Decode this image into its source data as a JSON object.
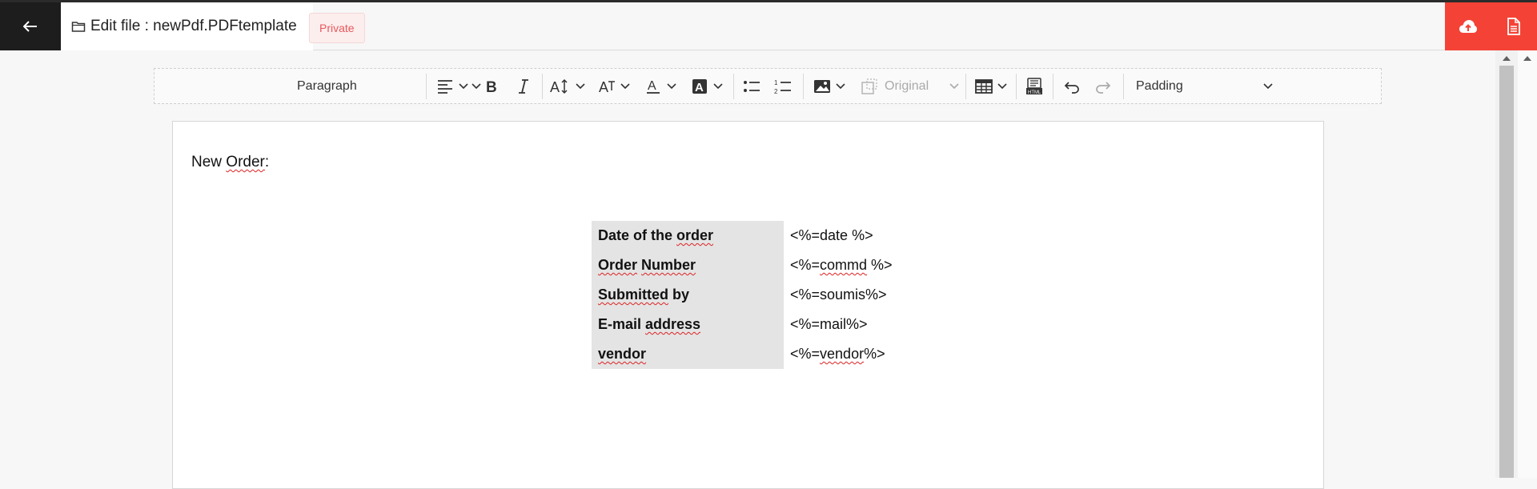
{
  "header": {
    "back_label": "←",
    "file_title": "Edit file : newPdf.PDFtemplate",
    "visibility_badge": "Private"
  },
  "actions": {
    "upload_icon": "cloud-upload-icon",
    "document_icon": "document-icon",
    "accent_color": "#f44336"
  },
  "toolbar": {
    "block_format": "Paragraph",
    "image_size": "Original",
    "padding": "Padding",
    "icons": [
      "align-left-icon",
      "bold-icon",
      "italic-icon",
      "font-size-icon",
      "font-family-icon",
      "font-color-icon",
      "highlight-icon",
      "bulleted-list-icon",
      "numbered-list-icon",
      "image-icon",
      "image-resize-icon",
      "table-icon",
      "source-editing-icon",
      "undo-icon",
      "redo-icon"
    ]
  },
  "document": {
    "heading_prefix": "New ",
    "heading_word": "Order",
    "heading_suffix": ":",
    "rows": [
      {
        "key": [
          "Date of the ",
          "order"
        ],
        "value": [
          "<%=date %>"
        ]
      },
      {
        "key": [
          "Order",
          " ",
          "Number"
        ],
        "value": [
          "<%=",
          "commd",
          " %>"
        ]
      },
      {
        "key": [
          "Submitted",
          " by"
        ],
        "value": [
          "<%=soumis%>"
        ]
      },
      {
        "key": [
          "E-mail ",
          "address"
        ],
        "value": [
          "<%=mail%>"
        ]
      },
      {
        "key": [
          "vendor"
        ],
        "value": [
          "<%=",
          "vendor",
          "%>"
        ]
      }
    ]
  }
}
